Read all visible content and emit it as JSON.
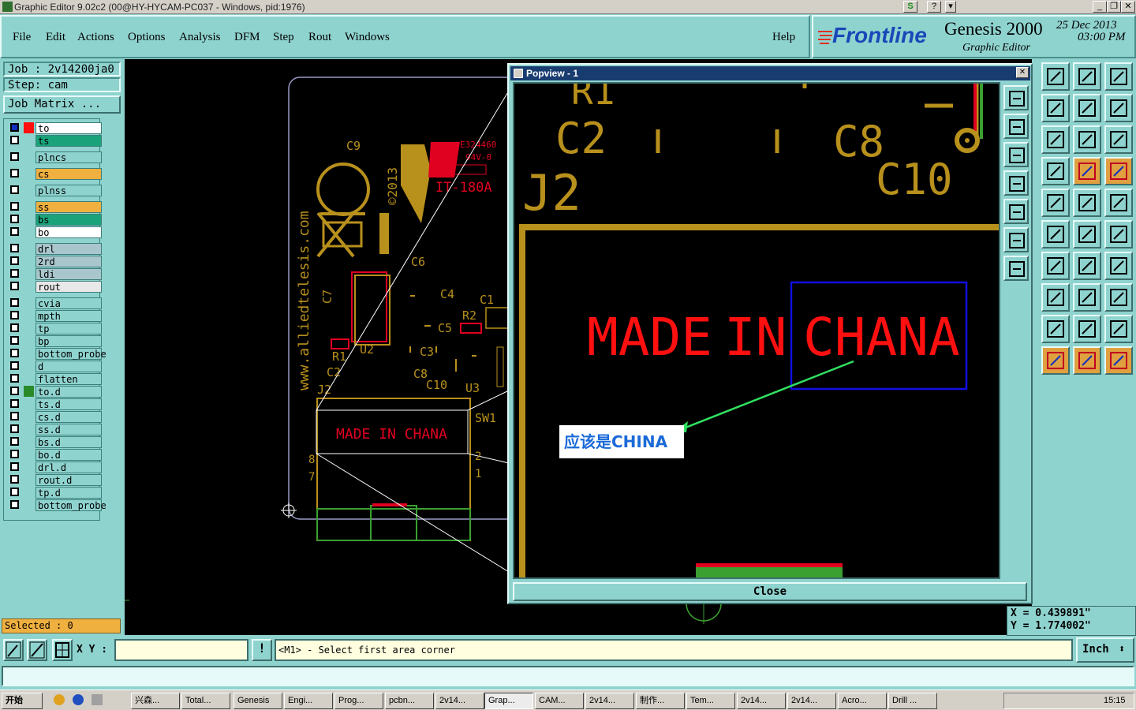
{
  "window": {
    "title": "Graphic Editor 9.02c2 (00@HY-HYCAM-PC037 - Windows, pid:1976)"
  },
  "menu": [
    "File",
    "Edit",
    "Actions",
    "Options",
    "Analysis",
    "DFM",
    "Step",
    "Rout",
    "Windows"
  ],
  "help_label": "Help",
  "brand": {
    "logo": "Frontline",
    "product": "Genesis 2000",
    "subtitle": "Graphic Editor",
    "date": "25 Dec 2013",
    "time": "03:00 PM"
  },
  "job": {
    "job_label": "Job : 2v14200ja0",
    "step_label": "Step: cam",
    "matrix_button": "Job Matrix ..."
  },
  "layers": [
    {
      "name": "to",
      "color": "#ffffff"
    },
    {
      "name": "ts",
      "color": "#1aa37a"
    },
    {
      "name": "plncs",
      "color": "#8fd3cf"
    },
    {
      "name": "cs",
      "color": "#f0b040"
    },
    {
      "name": "plnss",
      "color": "#8fd3cf"
    },
    {
      "name": "ss",
      "color": "#f0b040"
    },
    {
      "name": "bs",
      "color": "#1aa37a"
    },
    {
      "name": "bo",
      "color": "#ffffff"
    },
    {
      "name": "drl",
      "color": "#a9c6cc"
    },
    {
      "name": "2rd",
      "color": "#a9c6cc"
    },
    {
      "name": "ldi",
      "color": "#a9c6cc"
    },
    {
      "name": "rout",
      "color": "#e8e8e8"
    },
    {
      "name": "cvia",
      "color": "#8fd3cf"
    },
    {
      "name": "mpth",
      "color": "#8fd3cf"
    },
    {
      "name": "tp",
      "color": "#8fd3cf"
    },
    {
      "name": "bp",
      "color": "#8fd3cf"
    },
    {
      "name": "bottom_probe",
      "color": "#8fd3cf"
    },
    {
      "name": "d",
      "color": "#8fd3cf"
    },
    {
      "name": "flatten",
      "color": "#8fd3cf"
    },
    {
      "name": "to.d",
      "color": "#8fd3cf"
    },
    {
      "name": "ts.d",
      "color": "#8fd3cf"
    },
    {
      "name": "cs.d",
      "color": "#8fd3cf"
    },
    {
      "name": "ss.d",
      "color": "#8fd3cf"
    },
    {
      "name": "bs.d",
      "color": "#8fd3cf"
    },
    {
      "name": "bo.d",
      "color": "#8fd3cf"
    },
    {
      "name": "drl.d",
      "color": "#8fd3cf"
    },
    {
      "name": "rout.d",
      "color": "#8fd3cf"
    },
    {
      "name": "tp.d",
      "color": "#8fd3cf"
    },
    {
      "name": "bottom_probe",
      "color": "#8fd3cf"
    }
  ],
  "selected_label": "Selected : 0",
  "board": {
    "url_text": "www.alliedtelesis.com",
    "year": "©2013",
    "ul": "E324460",
    "rating": "94V-0",
    "it_code": "IT-180A",
    "labels": [
      "C9",
      "C6",
      "C7",
      "C4",
      "C1",
      "R2",
      "C5",
      "U2",
      "C3",
      "R1",
      "C2",
      "C8",
      "C10",
      "J2",
      "U3",
      "SW1"
    ],
    "silk_text": "MADE IN CHANA",
    "pins": [
      "8",
      "7",
      "2",
      "1"
    ]
  },
  "popview": {
    "title": "Popview - 1",
    "labels": [
      "R1",
      "C2",
      "C8",
      "C10",
      "J2"
    ],
    "text_made": "MADE",
    "text_in": "IN",
    "text_chana": "CHANA",
    "annotation": "应该是CHINA",
    "close_label": "Close"
  },
  "coords": {
    "x": "X = 0.439891\"",
    "y": "Y = 1.774002\""
  },
  "status": {
    "xy_label": "X Y :",
    "xy_value": "",
    "prompt": "<M1> - Select first area corner",
    "unit": "Inch"
  },
  "taskbar": {
    "start": "开始",
    "tasks": [
      "兴森...",
      "Total...",
      "Genesis",
      "Engi...",
      "Prog...",
      "pcbn...",
      "2v14...",
      "Grap...",
      "CAM...",
      "2v14...",
      "制作...",
      "Tem...",
      "2v14...",
      "2v14...",
      "Acro...",
      "Drill ..."
    ],
    "clock": "15:15"
  }
}
